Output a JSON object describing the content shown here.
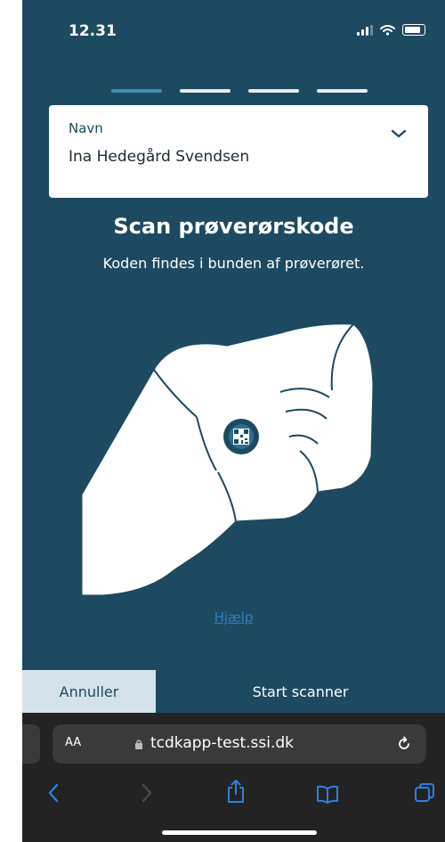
{
  "status_bar": {
    "time": "12.31"
  },
  "steps": {
    "total": 4,
    "active": 1
  },
  "name_field": {
    "label": "Navn",
    "value": "Ina Hedegård Svendsen"
  },
  "title": "Scan prøverørskode",
  "subtitle": "Koden findes i bunden af prøverøret.",
  "help_link": "Hjælp",
  "buttons": {
    "cancel": "Annuller",
    "start": "Start scanner"
  },
  "browser": {
    "aa": "AA",
    "url": "tcdkapp-test.ssi.dk"
  },
  "colors": {
    "background": "#1d4a60",
    "accent": "#3e8fb0",
    "link": "#2f7fc1",
    "cancel_bg": "#d4e2ea"
  },
  "icons": [
    "signal-icon",
    "wifi-icon",
    "battery-icon",
    "chevron-down-icon",
    "hand-illustration",
    "qr-code-icon",
    "lock-icon",
    "reload-icon",
    "back-icon",
    "forward-icon",
    "share-icon",
    "bookmarks-icon",
    "tabs-icon"
  ]
}
